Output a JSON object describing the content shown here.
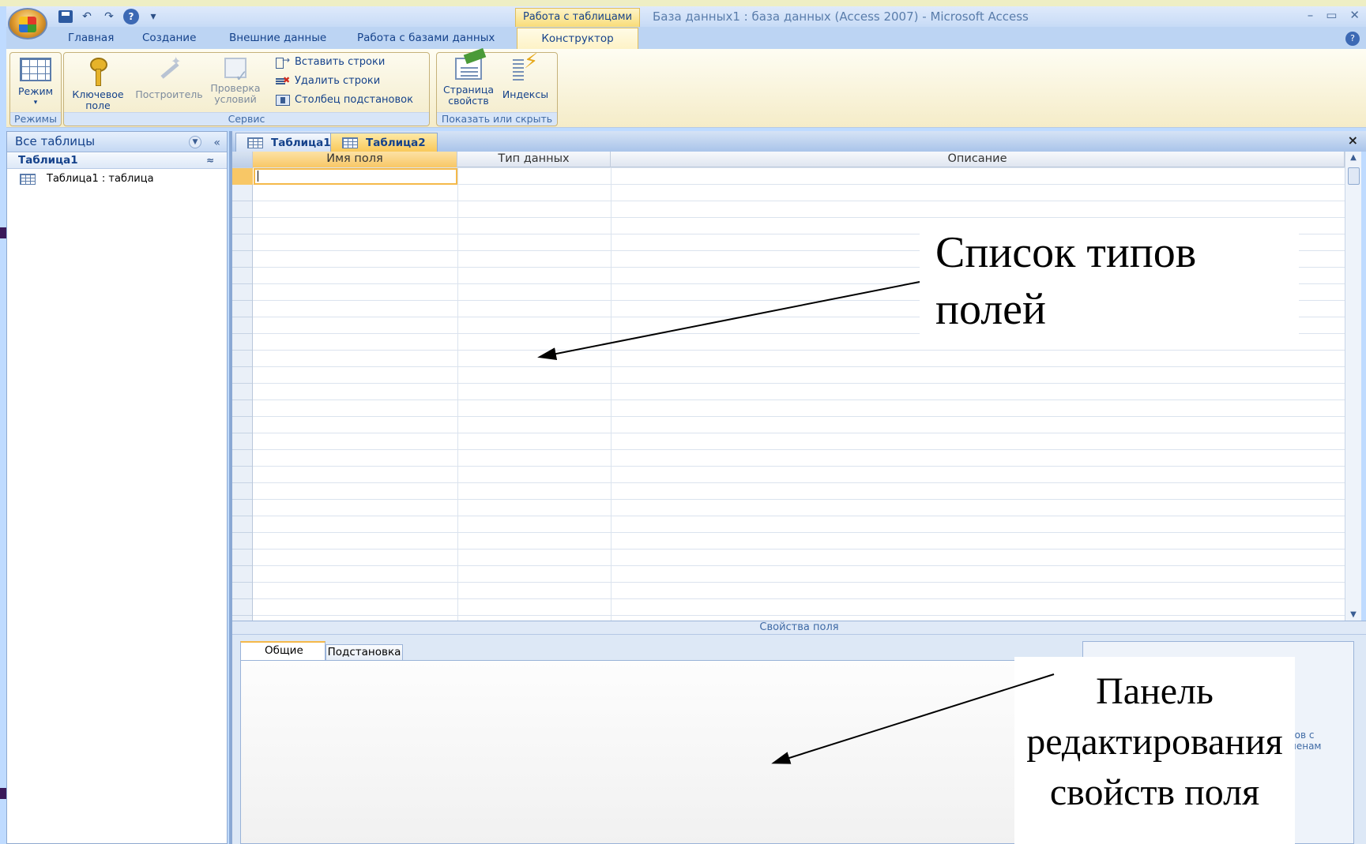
{
  "window": {
    "context_group": "Работа с таблицами",
    "title": "База данных1 : база данных (Access 2007) - Microsoft Access",
    "controls": [
      "–",
      "▭",
      "✕"
    ]
  },
  "qat": {
    "undo": "↶",
    "redo": "↷",
    "help": "?",
    "customize": "▾"
  },
  "ribbon_tabs": [
    "Главная",
    "Создание",
    "Внешние данные",
    "Работа с базами данных",
    "Конструктор"
  ],
  "ribbon": {
    "groups": {
      "modes": {
        "label": "Режимы",
        "view_button": "Режим"
      },
      "service": {
        "label": "Сервис",
        "primary_key": [
          "Ключевое",
          "поле"
        ],
        "builder": "Построитель",
        "validation": [
          "Проверка",
          "условий"
        ],
        "insert_rows": "Вставить строки",
        "delete_rows": "Удалить строки",
        "lookup_column": "Столбец подстановок"
      },
      "show_hide": {
        "label": "Показать или скрыть",
        "property_sheet": [
          "Страница",
          "свойств"
        ],
        "indexes": "Индексы"
      }
    }
  },
  "nav_pane": {
    "header": "Все таблицы",
    "collapse_glyph": "«",
    "group": "Таблица1",
    "group_glyph": "≈",
    "items": [
      {
        "label": "Таблица1 : таблица"
      }
    ]
  },
  "documents": {
    "tabs": [
      {
        "label": "Таблица1",
        "active": false
      },
      {
        "label": "Таблица2",
        "active": true
      }
    ],
    "close_glyph": "×"
  },
  "design_grid": {
    "columns": [
      "Имя поля",
      "Тип данных",
      "Описание"
    ],
    "rows_visible": 26
  },
  "field_properties": {
    "title": "Свойства поля",
    "tabs": [
      "Общие",
      "Подстановка"
    ],
    "help_text_fragment": "аков с\nименам\n."
  },
  "annotations": {
    "field_types": "Список типов полей",
    "properties_panel": "Панель редактирования свойств поля"
  },
  "colors": {
    "ribbon_accent": "#f8c766",
    "nav_text": "#15428b",
    "frame": "#bfdbff"
  }
}
